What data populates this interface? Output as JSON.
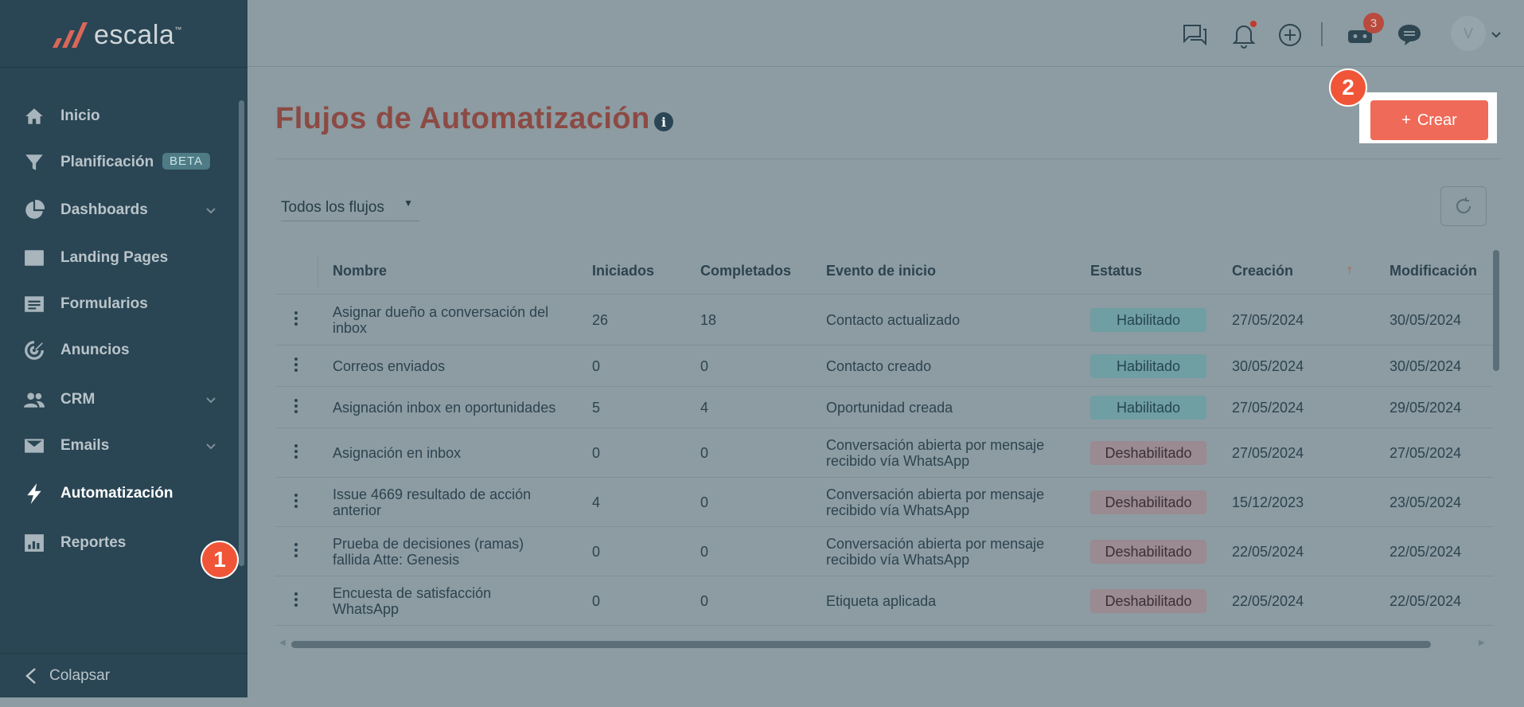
{
  "brand": {
    "name": "escala",
    "tm": "™"
  },
  "sidebar": {
    "items": [
      {
        "label": "Inicio",
        "icon": "home-icon"
      },
      {
        "label": "Planificación",
        "icon": "funnel-icon",
        "badge": "BETA"
      },
      {
        "label": "Dashboards",
        "icon": "pie-chart-icon"
      },
      {
        "label": "Landing Pages",
        "icon": "browser-window-icon"
      },
      {
        "label": "Formularios",
        "icon": "form-icon"
      },
      {
        "label": "Anuncios",
        "icon": "target-icon"
      },
      {
        "label": "CRM",
        "icon": "users-icon"
      },
      {
        "label": "Emails",
        "icon": "envelope-icon"
      },
      {
        "label": "Automatización",
        "icon": "lightning-icon",
        "active": true
      },
      {
        "label": "Reportes",
        "icon": "bar-report-icon"
      }
    ],
    "collapse_label": "Colapsar"
  },
  "markers": {
    "one": "1",
    "two": "2"
  },
  "topbar": {
    "bot_count": "3",
    "avatar_initial": "V"
  },
  "page": {
    "title": "Flujos de Automatización",
    "info": "i",
    "create_label": "Crear",
    "create_plus": "+",
    "filter_value": "Todos los flujos"
  },
  "table": {
    "headers": {
      "name": "Nombre",
      "started": "Iniciados",
      "completed": "Completados",
      "trigger": "Evento de inicio",
      "status": "Estatus",
      "created": "Creación",
      "modified": "Modificación"
    },
    "sort_indicator": "↑",
    "rows": [
      {
        "name": [
          "Asignar dueño a conversación del",
          "inbox"
        ],
        "started": "26",
        "completed": "18",
        "trigger": [
          "Contacto actualizado"
        ],
        "status": "Habilitado",
        "enabled": true,
        "created": "27/05/2024",
        "modified": "30/05/2024"
      },
      {
        "name": [
          "Correos enviados"
        ],
        "started": "0",
        "completed": "0",
        "trigger": [
          "Contacto creado"
        ],
        "status": "Habilitado",
        "enabled": true,
        "created": "30/05/2024",
        "modified": "30/05/2024"
      },
      {
        "name": [
          "Asignación inbox en oportunidades"
        ],
        "started": "5",
        "completed": "4",
        "trigger": [
          "Oportunidad creada"
        ],
        "status": "Habilitado",
        "enabled": true,
        "created": "27/05/2024",
        "modified": "29/05/2024"
      },
      {
        "name": [
          "Asignación en inbox"
        ],
        "started": "0",
        "completed": "0",
        "trigger": [
          "Conversación abierta por mensaje",
          "recibido vía WhatsApp"
        ],
        "status": "Deshabilitado",
        "enabled": false,
        "created": "27/05/2024",
        "modified": "27/05/2024"
      },
      {
        "name": [
          "Issue 4669 resultado de acción",
          "anterior"
        ],
        "started": "4",
        "completed": "0",
        "trigger": [
          "Conversación abierta por mensaje",
          "recibido vía WhatsApp"
        ],
        "status": "Deshabilitado",
        "enabled": false,
        "created": "15/12/2023",
        "modified": "23/05/2024"
      },
      {
        "name": [
          "Prueba de decisiones (ramas)",
          "fallida Atte: Genesis"
        ],
        "started": "0",
        "completed": "0",
        "trigger": [
          "Conversación abierta por mensaje",
          "recibido vía WhatsApp"
        ],
        "status": "Deshabilitado",
        "enabled": false,
        "created": "22/05/2024",
        "modified": "22/05/2024"
      },
      {
        "name": [
          "Encuesta de satisfacción",
          "WhatsApp"
        ],
        "started": "0",
        "completed": "0",
        "trigger": [
          "Etiqueta aplicada"
        ],
        "status": "Deshabilitado",
        "enabled": false,
        "created": "22/05/2024",
        "modified": "22/05/2024"
      }
    ]
  },
  "colors": {
    "sidebar_bg": "#2a4553",
    "overlay_bg": "#8c9ca2",
    "accent": "#ef6a58",
    "marker": "#f05537"
  }
}
